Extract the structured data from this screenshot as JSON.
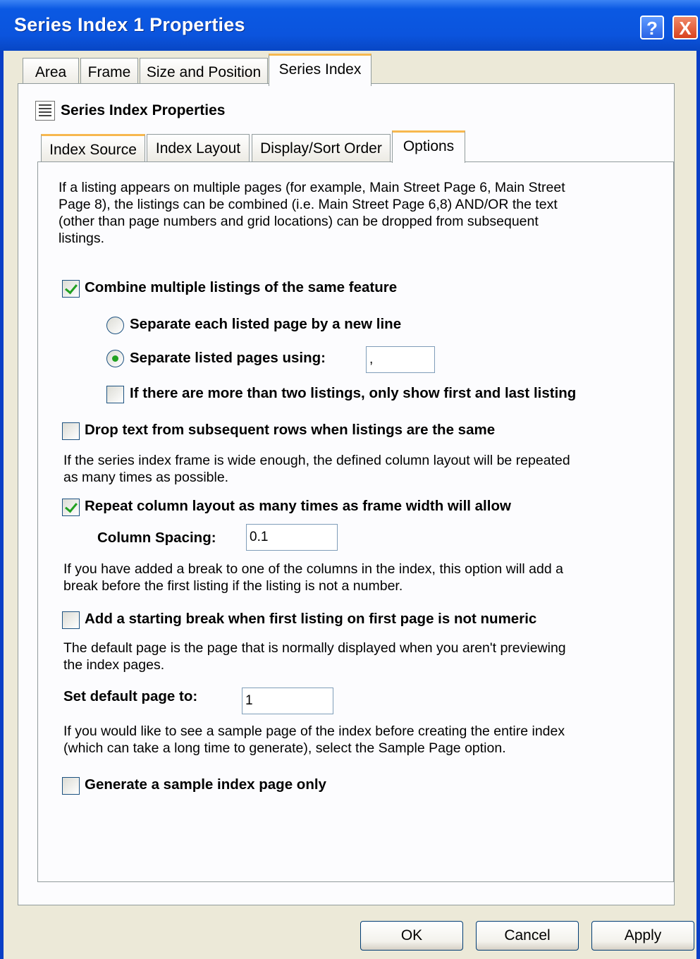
{
  "window": {
    "title": "Series Index 1 Properties",
    "help_label": "?",
    "close_label": "X"
  },
  "outer_tabs": [
    "Area",
    "Frame",
    "Size and Position",
    "Series Index"
  ],
  "section_title": "Series Index Properties",
  "inner_tabs": [
    "Index Source",
    "Index Layout",
    "Display/Sort Order",
    "Options"
  ],
  "options": {
    "intro": [
      "If a listing appears on multiple pages (for example, Main Street Page 6, Main Street",
      "Page 8), the listings can be combined (i.e. Main Street Page 6,8) AND/OR the text",
      "(other than page numbers and grid locations) can be dropped from subsequent",
      "listings."
    ],
    "combine_label": "Combine multiple listings of the same feature",
    "combine_checked": true,
    "sep_new_line_label": "Separate each listed page by a  new line",
    "sep_using_label": "Separate listed pages using:",
    "sep_using_value": ",",
    "sep_using_selected": true,
    "first_last_label": "If there are more than two listings, only show first and last listing",
    "first_last_checked": false,
    "drop_text_label": "Drop text from subsequent rows when listings are the same",
    "drop_text_checked": false,
    "repeat_desc": [
      "If the series index frame is wide enough, the defined column layout will be repeated",
      "as many times as possible."
    ],
    "repeat_label": "Repeat column layout as many times as frame width will allow",
    "repeat_checked": true,
    "column_spacing_label": "Column Spacing:",
    "column_spacing_value": "0.1",
    "break_desc": [
      "If you have added a break to one of the columns in the index, this option will add a",
      "break before the first listing if the listing is not a number."
    ],
    "break_label": "Add a starting break when first listing on first page is not numeric",
    "break_checked": false,
    "default_desc": [
      "The default page is the page that is normally displayed when you aren't previewing",
      "the index pages."
    ],
    "default_page_label": "Set default page to:",
    "default_page_value": "1",
    "sample_desc": [
      "If you would like to see a sample page of the index before creating the entire index",
      "(which can take a long time to generate), select the Sample Page option."
    ],
    "sample_label": "Generate a sample index page only",
    "sample_checked": false
  },
  "buttons": {
    "ok": "OK",
    "cancel": "Cancel",
    "apply": "Apply"
  }
}
